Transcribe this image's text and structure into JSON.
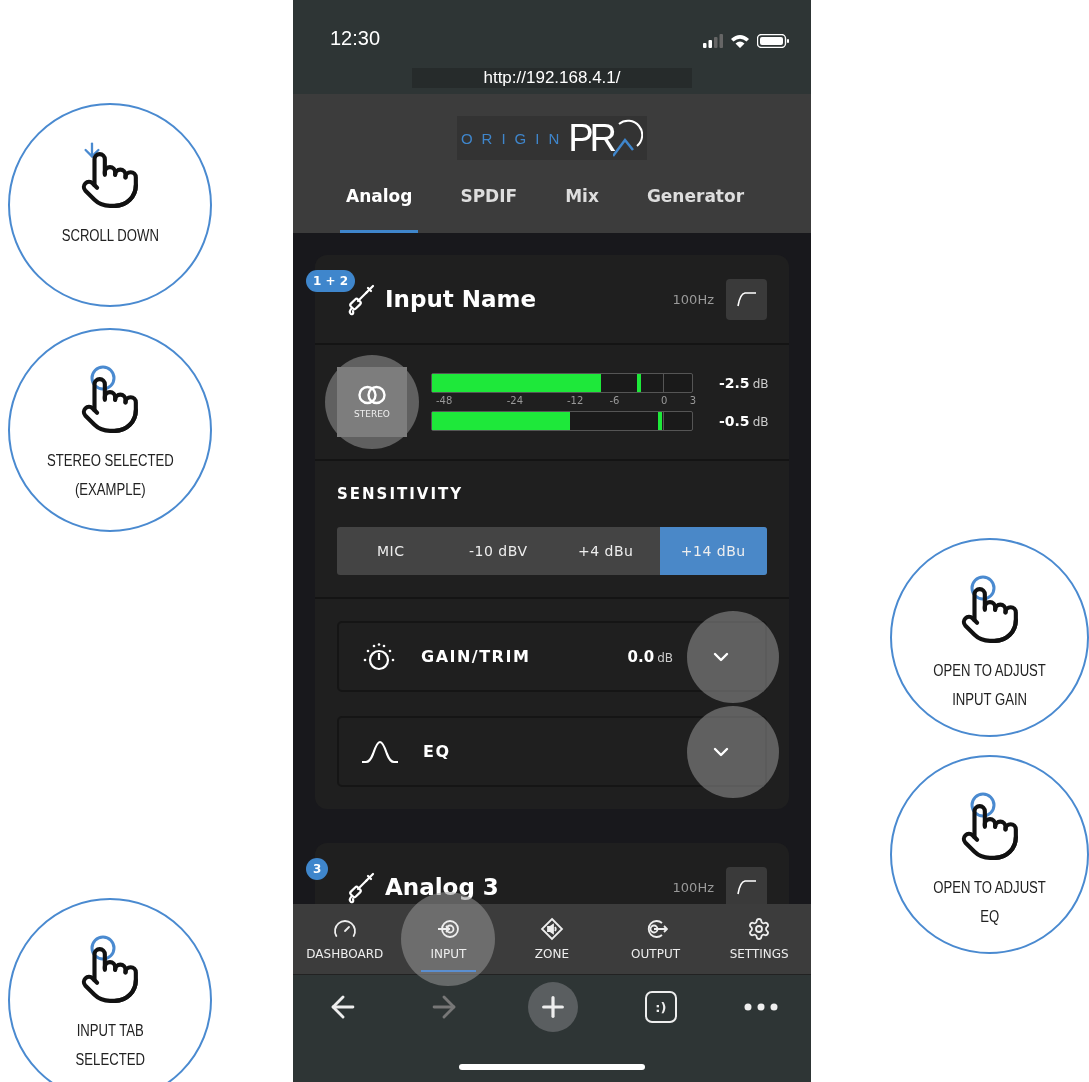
{
  "status_bar": {
    "time": "12:30"
  },
  "url": "http://192.168.4.1/",
  "logo": {
    "text": "ORIGIN",
    "mark": "PR"
  },
  "tabs": [
    {
      "label": "Analog",
      "selected": true
    },
    {
      "label": "SPDIF",
      "selected": false
    },
    {
      "label": "Mix",
      "selected": false
    },
    {
      "label": "Generator",
      "selected": false
    }
  ],
  "inputs": [
    {
      "badge": "1 + 2",
      "name": "Input Name",
      "filter": "100Hz",
      "mode": {
        "label": "STEREO",
        "touch_highlight": true
      },
      "meters": [
        {
          "level": 0.65,
          "peak": {
            "level": 0.79
          },
          "reading": "-2.5",
          "unit": "dB"
        },
        {
          "level": 0.53,
          "peak": {
            "level": 0.87
          },
          "reading": "-0.5",
          "unit": "dB"
        }
      ],
      "scale": [
        "-48",
        "-24",
        "-12",
        "-6",
        "0",
        "3"
      ],
      "sensitivity": {
        "title": "SENSITIVITY",
        "options": [
          {
            "label": "MIC",
            "selected": false
          },
          {
            "label": "-10 dBV",
            "selected": false
          },
          {
            "label": "+4 dBu",
            "selected": false
          },
          {
            "label": "+14 dBu",
            "selected": true
          }
        ]
      },
      "controls": [
        {
          "kind": "gain",
          "label": "GAIN/TRIM",
          "value": "0.0",
          "unit": "dB",
          "touch_highlight": true
        },
        {
          "kind": "eq",
          "label": "EQ",
          "touch_highlight": true
        }
      ]
    },
    {
      "badge": "3",
      "name": "Analog 3",
      "filter": "100Hz"
    }
  ],
  "nav": [
    {
      "kind": "dashboard",
      "label": "DASHBOARD",
      "selected": false,
      "touch_highlight": false
    },
    {
      "kind": "input",
      "label": "INPUT",
      "selected": true,
      "touch_highlight": true
    },
    {
      "kind": "zone",
      "label": "ZONE",
      "selected": false,
      "touch_highlight": false
    },
    {
      "kind": "output",
      "label": "OUTPUT",
      "selected": false,
      "touch_highlight": false
    },
    {
      "kind": "settings",
      "label": "SETTINGS",
      "selected": false,
      "touch_highlight": false
    }
  ],
  "browser_toolbar": {
    "forward_disabled": true,
    "tabs_label": ":)"
  },
  "callouts_left": [
    {
      "kind": "scroll",
      "text": "SCROLL DOWN"
    },
    {
      "kind": "tap",
      "text": "STEREO SELECTED\n(EXAMPLE)"
    },
    {
      "kind": "tap",
      "text": "INPUT TAB\nSELECTED"
    }
  ],
  "callouts_right": [
    {
      "kind": "tap",
      "text": "OPEN TO ADJUST\nINPUT GAIN"
    },
    {
      "kind": "tap",
      "text": "OPEN TO ADJUST\nEQ"
    }
  ]
}
